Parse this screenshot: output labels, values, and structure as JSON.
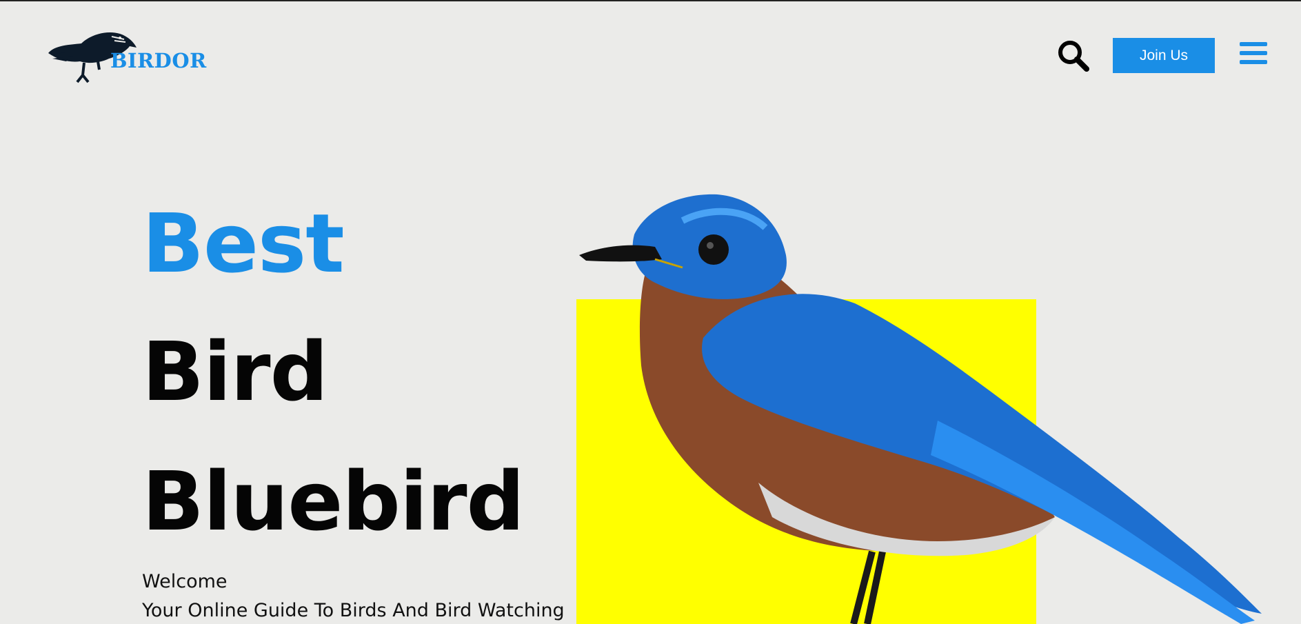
{
  "header": {
    "logo_text": "BIRDOR",
    "join_label": "Join Us"
  },
  "hero": {
    "line1": "Best",
    "line2": "Bird",
    "line3": "Bluebird",
    "welcome": "Welcome",
    "tagline": "Your Online Guide To Birds And Bird Watching"
  },
  "colors": {
    "accent": "#1a8ee6",
    "background": "#ebebe9",
    "highlight": "#ffff00",
    "text": "#050505"
  },
  "icons": {
    "search": "search-icon",
    "menu": "hamburger-menu-icon",
    "logo": "bird-logo-icon"
  }
}
